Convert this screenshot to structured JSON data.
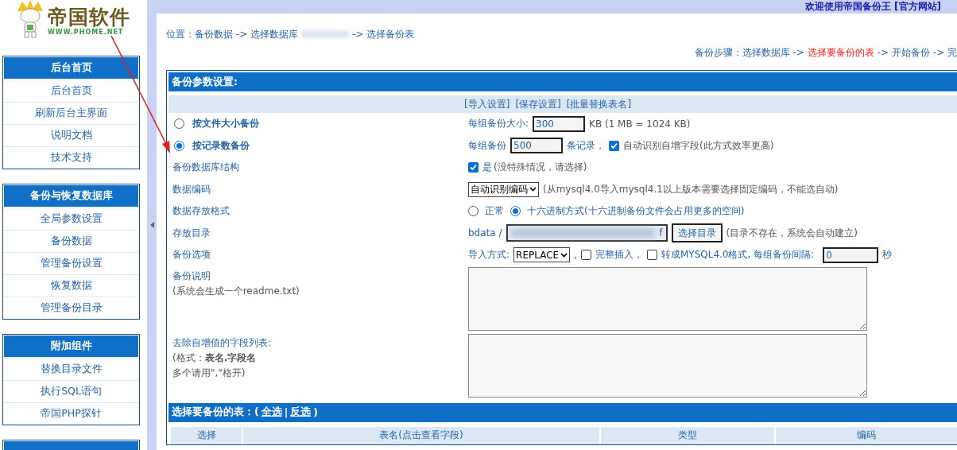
{
  "logo": {
    "name": "帝国软件",
    "url": "WWW.PHOME.NET"
  },
  "top_bar": {
    "welcome": "欢迎使用帝国备份王",
    "link": "[官方网站]"
  },
  "sidebar": {
    "groups": [
      {
        "title": "后台首页",
        "items": [
          "后台首页",
          "刷新后台主界面",
          "说明文档",
          "技术支持"
        ]
      },
      {
        "title": "备份与恢复数据库",
        "items": [
          "全局参数设置",
          "备份数据",
          "管理备份设置",
          "恢复数据",
          "管理备份目录"
        ]
      },
      {
        "title": "附加组件",
        "items": [
          "替换目录文件",
          "执行SQL语句",
          "帝国PHP探针"
        ]
      },
      {
        "kind": "header_only"
      }
    ]
  },
  "breadcrumb": [
    {
      "kind": "text",
      "text": "位置：备份数据 -> 选择数据库"
    },
    {
      "kind": "redacted"
    },
    {
      "kind": "text",
      "text": "-> 选择备份表"
    }
  ],
  "steps": [
    {
      "text": "备份步骤：选择数据库 ->",
      "selected": false
    },
    {
      "text": "选择要备份的表",
      "selected": true
    },
    {
      "text": "-> 开始备份 -> 完",
      "selected": false
    }
  ],
  "settings": {
    "title": "备份参数设置:",
    "links": [
      "[导入设置]",
      "[保存设置]",
      "[批量替换表名]"
    ],
    "mode_options": [
      {
        "label": "按文件大小备份",
        "selected": false,
        "prefix": "每组备份大小:",
        "value": "300",
        "suffix": "KB (1 MB = 1024 KB)"
      },
      {
        "label": "按记录数备份",
        "selected": true,
        "prefix": "每组备份",
        "value": "500",
        "suffix": "条记录，",
        "check": {
          "label": "自动识别自增字段(此方式效率更高)",
          "checked": true
        }
      }
    ],
    "structure": {
      "label": "备份数据库结构",
      "checked": true,
      "option": "是",
      "note": "(没特殊情况，请选择)"
    },
    "encoding": {
      "label": "数据编码",
      "value": "自动识别编码",
      "note": "(从mysql4.0导入mysql4.1以上版本需要选择固定编码，不能选自动)"
    },
    "format": {
      "label": "数据存放格式",
      "options": [
        {
          "label": "正常",
          "selected": false
        },
        {
          "label": "十六进制方式(十六进制备份文件会占用更多的空间)",
          "selected": true
        }
      ]
    },
    "directory": {
      "label": "存放目录",
      "prefix": "bdata /",
      "value": "f",
      "button": "选择目录",
      "note": "(目录不存在，系统会自动建立)"
    },
    "options": {
      "label": "备份选项",
      "import_label": "导入方式:",
      "import_value": "REPLACE",
      "comma": ",",
      "full_insert": {
        "label": "完整插入，",
        "checked": false
      },
      "mysql40": {
        "label": "转成MYSQL4.0格式, 每组备份间隔:",
        "checked": false
      },
      "interval": "0",
      "unit": "秒"
    },
    "readme": {
      "label": "备份说明",
      "hint": "(系统会生成一个readme.txt)"
    },
    "autoinc": {
      "label": "去除自增值的字段列表:",
      "hint_lines": [
        "(格式：**表名.字段名**",
        "多个请用\",\"格开)"
      ]
    }
  },
  "tables": {
    "title": "选择要备份的表：(",
    "select_all": "全选",
    "divider": "|",
    "invert": "反选",
    "close": ")",
    "columns": [
      "选择",
      "表名(点击查看字段)",
      "类型",
      "编码"
    ]
  }
}
